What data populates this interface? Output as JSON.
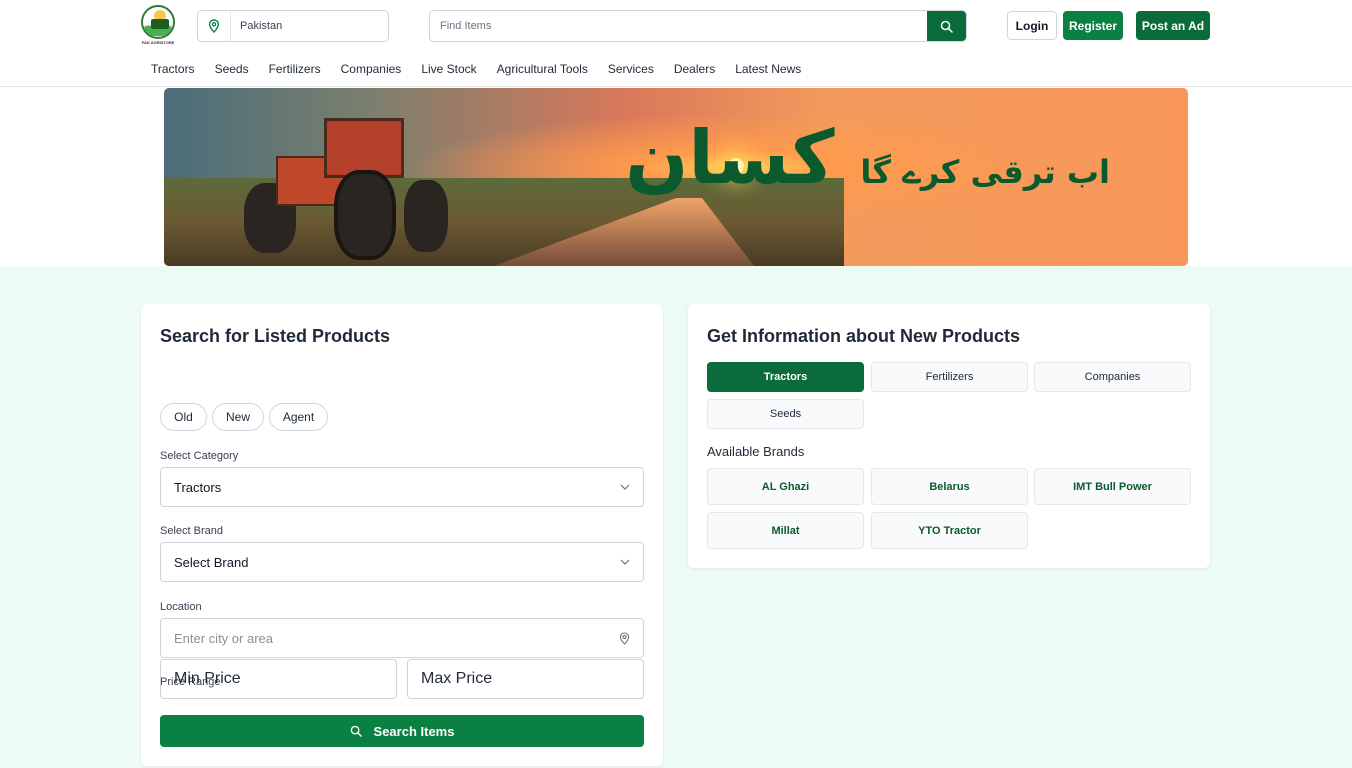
{
  "header": {
    "logo_text": "PAK AGRISTORE",
    "location": "Pakistan",
    "search_placeholder": "Find Items",
    "login_label": "Login",
    "register_label": "Register",
    "post_ad_label": "Post an Ad"
  },
  "nav": [
    "Tractors",
    "Seeds",
    "Fertilizers",
    "Companies",
    "Live Stock",
    "Agricultural Tools",
    "Services",
    "Dealers",
    "Latest News"
  ],
  "banner": {
    "tagline_small": "اب ترقی کرے گا",
    "tagline_big": "کسان"
  },
  "search_card": {
    "title": "Search for Listed Products",
    "filters": [
      "Old",
      "New",
      "Agent"
    ],
    "category_label": "Select Category",
    "category_value": "Tractors",
    "brand_label": "Select Brand",
    "brand_value": "Select Brand",
    "location_label": "Location",
    "location_placeholder": "Enter city or area",
    "price_label": "Price Range",
    "min_price_placeholder": "Min Price",
    "max_price_placeholder": "Max Price",
    "search_button": "Search Items"
  },
  "info_card": {
    "title": "Get Information about New Products",
    "tabs": [
      "Tractors",
      "Fertilizers",
      "Companies",
      "Seeds"
    ],
    "active_tab": "Tractors",
    "brands_label": "Available Brands",
    "brands": [
      "AL Ghazi",
      "Belarus",
      "IMT Bull Power",
      "Millat",
      "YTO Tractor"
    ]
  },
  "colors": {
    "primary": "#0b8043",
    "primary_dark": "#0b6b3a",
    "section_bg": "#ecfbf3"
  }
}
